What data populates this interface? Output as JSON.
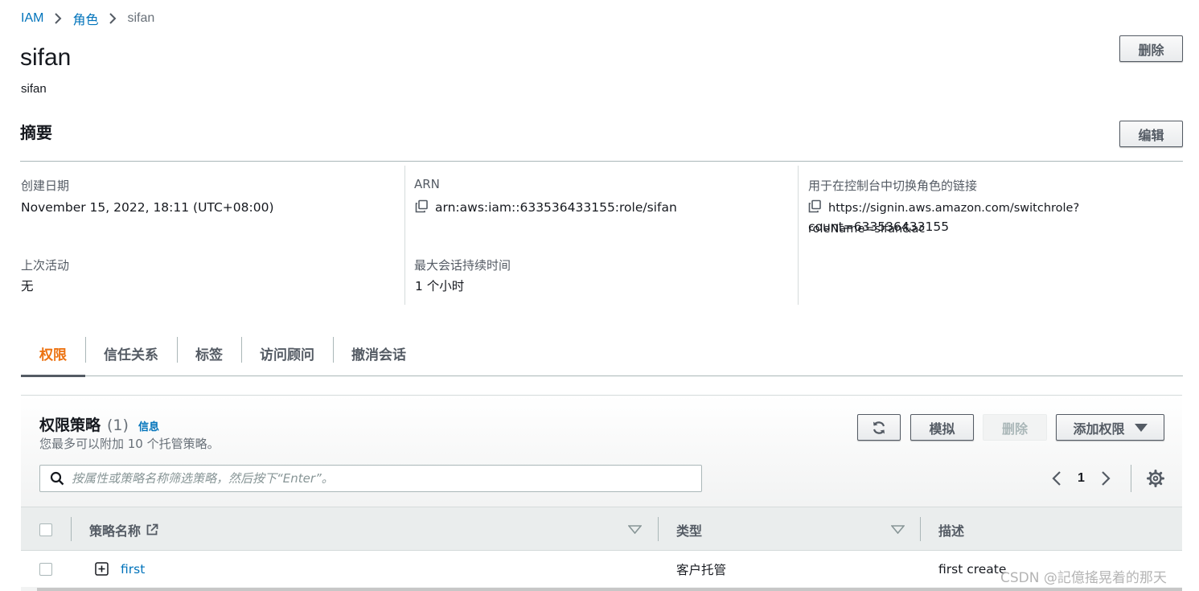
{
  "breadcrumb": {
    "root": "IAM",
    "section": "角色",
    "current": "sifan"
  },
  "header": {
    "title": "sifan",
    "subtitle": "sifan",
    "delete_label": "删除"
  },
  "summary": {
    "title": "摘要",
    "edit_label": "编辑",
    "created_label": "创建日期",
    "created_value": "November 15, 2022, 18:11 (UTC+08:00)",
    "last_activity_label": "上次活动",
    "last_activity_value": "无",
    "arn_label": "ARN",
    "arn_value": "arn:aws:iam::633536433155:role/sifan",
    "max_session_label": "最大会话持续时间",
    "max_session_value": "1 个小时",
    "switch_link_label": "用于在控制台中切换角色的链接",
    "switch_link_line1": "https://signin.aws.amazon.com/switchrole?roleName=sifan&ac",
    "switch_link_line2": "count=633536433155"
  },
  "tabs": [
    {
      "label": "权限",
      "active": true
    },
    {
      "label": "信任关系"
    },
    {
      "label": "标签"
    },
    {
      "label": "访问顾问"
    },
    {
      "label": "撤消会话"
    }
  ],
  "policies": {
    "title": "权限策略",
    "count": "(1)",
    "info_label": "信息",
    "description": "您最多可以附加 10 个托管策略。",
    "simulate_label": "模拟",
    "remove_label": "删除",
    "add_label": "添加权限",
    "search_placeholder": "按属性或策略名称筛选策略，然后按下“Enter”。",
    "page_number": "1",
    "columns": {
      "name": "策略名称",
      "type": "类型",
      "description": "描述"
    },
    "rows": [
      {
        "name": "first",
        "type": "客户托管",
        "description": "first create"
      }
    ]
  },
  "watermark": "CSDN @記億搖晃着的那天",
  "colors": {
    "link": "#0073bb",
    "active_tab": "#ec7211",
    "text": "#16191f",
    "muted": "#545b64"
  }
}
